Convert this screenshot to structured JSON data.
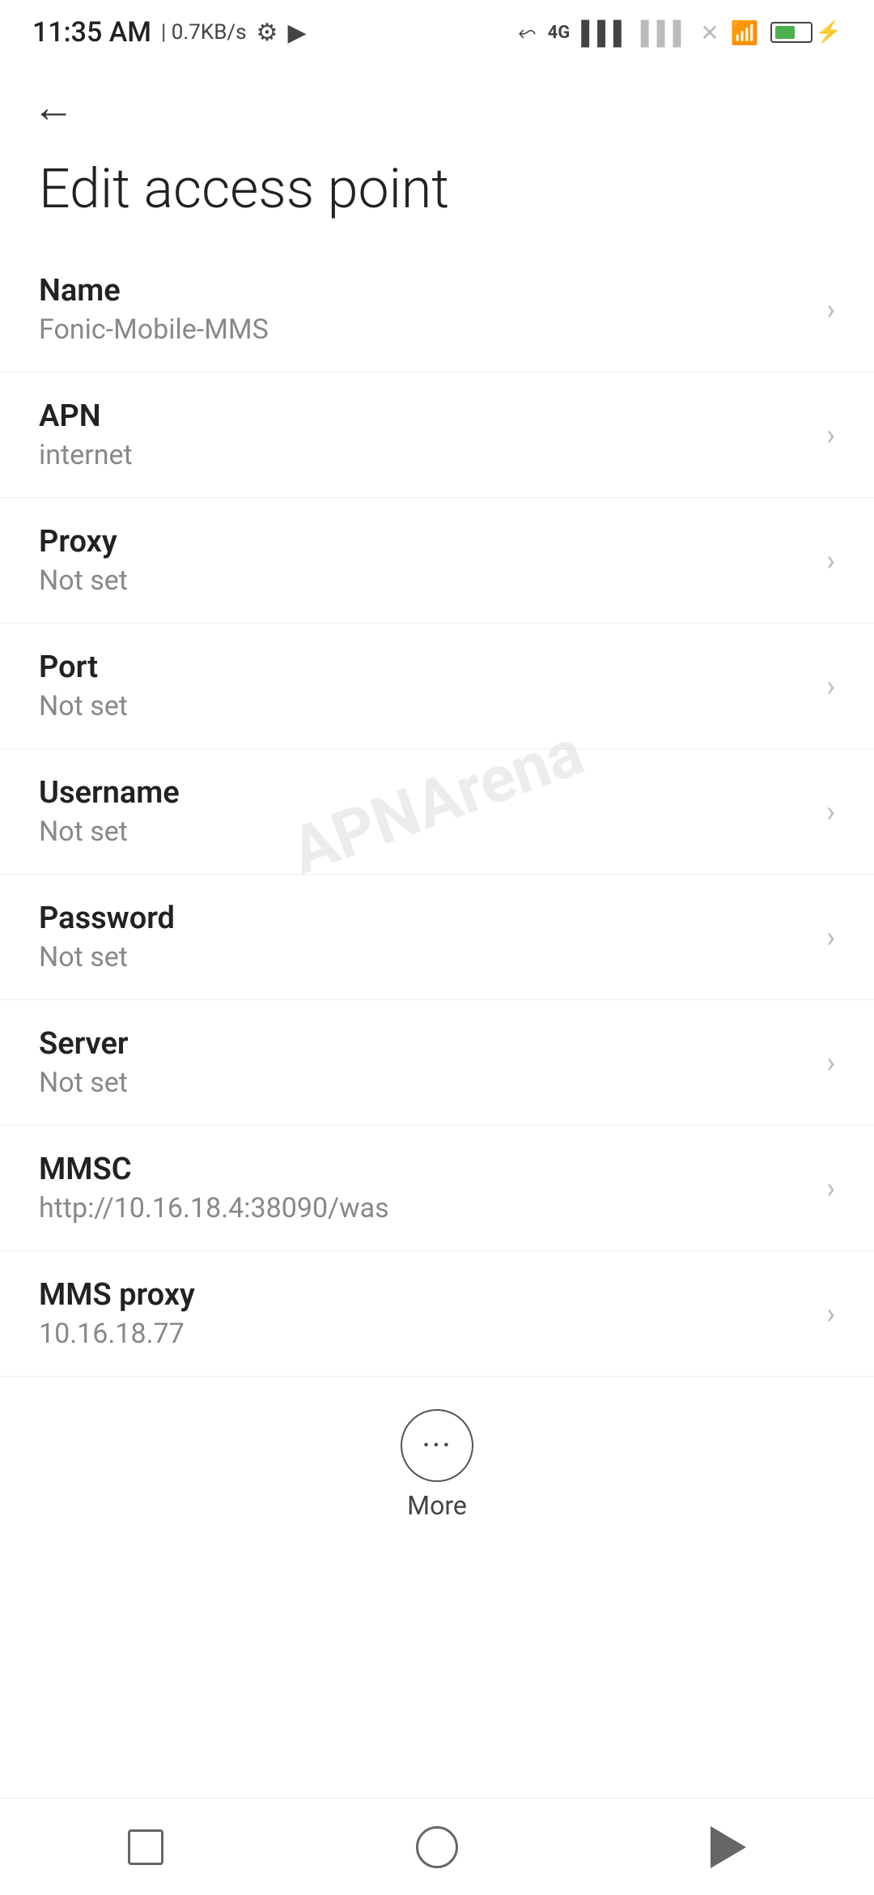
{
  "statusBar": {
    "time": "11:35 AM",
    "speed": "0.7KB/s",
    "icons": [
      "settings-icon",
      "video-icon",
      "bluetooth-icon",
      "signal-4g-icon",
      "signal-bars-icon",
      "wifi-icon",
      "battery-icon",
      "bolt-icon"
    ]
  },
  "header": {
    "backLabel": "←",
    "title": "Edit access point"
  },
  "settings": {
    "items": [
      {
        "label": "Name",
        "value": "Fonic-Mobile-MMS"
      },
      {
        "label": "APN",
        "value": "internet"
      },
      {
        "label": "Proxy",
        "value": "Not set"
      },
      {
        "label": "Port",
        "value": "Not set"
      },
      {
        "label": "Username",
        "value": "Not set"
      },
      {
        "label": "Password",
        "value": "Not set"
      },
      {
        "label": "Server",
        "value": "Not set"
      },
      {
        "label": "MMSC",
        "value": "http://10.16.18.4:38090/was"
      },
      {
        "label": "MMS proxy",
        "value": "10.16.18.77"
      }
    ]
  },
  "more": {
    "label": "More"
  },
  "bottomNav": {
    "square": "recent-apps-button",
    "circle": "home-button",
    "back": "back-button"
  },
  "watermark": "APNArena"
}
